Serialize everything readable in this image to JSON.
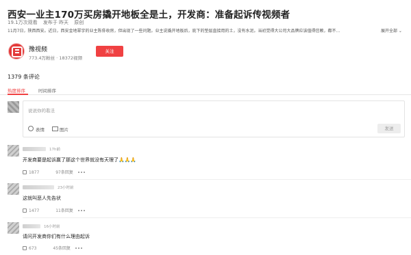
{
  "article": {
    "title": "西安一业主170万买房撬开地板全是土，开发商：准备起诉传视频者",
    "views": "19.1万次观看",
    "published": "发布于 昨天",
    "tag": "原创",
    "summary": "11月7日，陕西西安。近日，西安金地翠宇的业主陈俳收房，但出现了一些问题。业主说撬开地板后，底下的垫层直接用的土，没有水泥。当初觉得大公司大品牌应该值得信赖，都不…",
    "expand_label": "展开全部 ⌄"
  },
  "author": {
    "name": "豫视频",
    "stats": "773.4万粉丝 · 18372视频",
    "follow_label": "关注"
  },
  "comments_header": {
    "count_label": "1379 条评论",
    "tabs": [
      "热度排序",
      "时间排序"
    ]
  },
  "composer": {
    "placeholder": "说说你的看法",
    "emoji_label": "表情",
    "image_label": "图片",
    "send_label": "发送"
  },
  "comments": [
    {
      "time": "17h前",
      "text": "开发商要是起诉赢了那这个世界就没有天理了🙏🙏🙏",
      "likes": "1877",
      "replies": "97条回复"
    },
    {
      "time": "23小时前",
      "text": "这就叫恶人先告状",
      "likes": "1477",
      "replies": "11条回复"
    },
    {
      "time": "16小时前",
      "text": "请问开发商你们有什么理由起诉",
      "likes": "673",
      "replies": "45条回复"
    }
  ],
  "colors": {
    "accent": "#f04142",
    "text": "#222222",
    "muted": "#777777"
  }
}
